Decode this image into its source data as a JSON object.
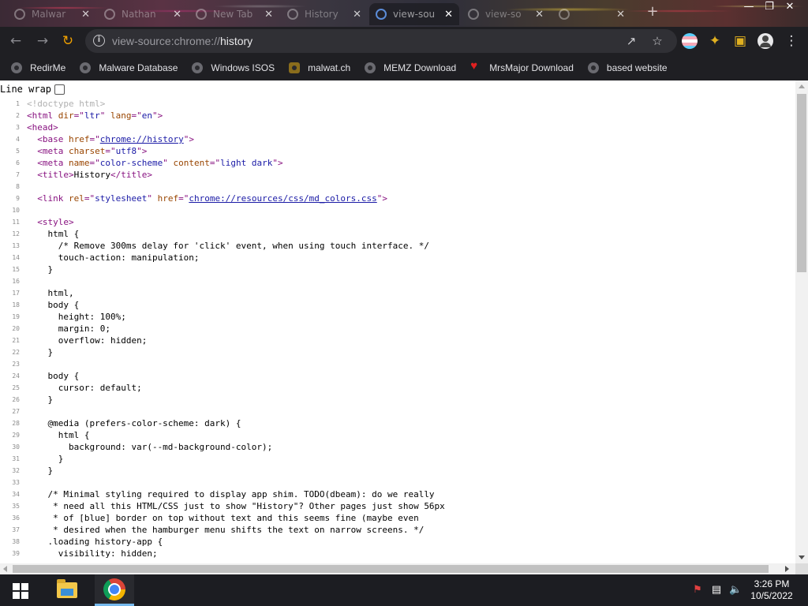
{
  "tabs": [
    {
      "title": "Malwar",
      "active": false
    },
    {
      "title": "Nathan",
      "active": false
    },
    {
      "title": "New Tab",
      "active": false
    },
    {
      "title": "History",
      "active": false
    },
    {
      "title": "view-sou",
      "active": true
    },
    {
      "title": "view-so",
      "active": false
    },
    {
      "title": "",
      "active": false
    }
  ],
  "tab_close_glyph": "✕",
  "new_tab_glyph": "+",
  "window_controls": {
    "minimize": "—",
    "maximize": "❐",
    "close": "✕"
  },
  "omnibox": {
    "scheme": "view-source:chrome://",
    "path": "history",
    "info_icon": "info-icon"
  },
  "bookmarks": [
    {
      "label": "RedirMe",
      "icon": "globe-icon"
    },
    {
      "label": "Malware Database",
      "icon": "globe-icon"
    },
    {
      "label": "Windows ISOS",
      "icon": "globe-icon"
    },
    {
      "label": "malwat.ch",
      "icon": "malwatch-icon"
    },
    {
      "label": "MEMZ Download",
      "icon": "globe-icon"
    },
    {
      "label": "MrsMajor Download",
      "icon": "heart-icon"
    },
    {
      "label": "based website",
      "icon": "globe-icon"
    }
  ],
  "line_wrap_label": "Line wrap",
  "source_lines": [
    {
      "n": "1",
      "html": "<span class='cmt'>&lt;!doctype html&gt;</span>"
    },
    {
      "n": "2",
      "html": "<span class='tag'>&lt;html </span><span class='attr'>dir</span><span class='tag'>=\"</span><span class='val'>ltr</span><span class='tag'>\" </span><span class='attr'>lang</span><span class='tag'>=\"</span><span class='val'>en</span><span class='tag'>\"&gt;</span>"
    },
    {
      "n": "3",
      "html": "<span class='tag'>&lt;head&gt;</span>"
    },
    {
      "n": "4",
      "html": "  <span class='tag'>&lt;base </span><span class='attr'>href</span><span class='tag'>=\"</span><span class='lnk'>chrome://history</span><span class='tag'>\"&gt;</span>"
    },
    {
      "n": "5",
      "html": "  <span class='tag'>&lt;meta </span><span class='attr'>charset</span><span class='tag'>=\"</span><span class='val'>utf8</span><span class='tag'>\"&gt;</span>"
    },
    {
      "n": "6",
      "html": "  <span class='tag'>&lt;meta </span><span class='attr'>name</span><span class='tag'>=\"</span><span class='val'>color-scheme</span><span class='tag'>\" </span><span class='attr'>content</span><span class='tag'>=\"</span><span class='val'>light dark</span><span class='tag'>\"&gt;</span>"
    },
    {
      "n": "7",
      "html": "  <span class='tag'>&lt;title&gt;</span>History<span class='tag'>&lt;/title&gt;</span>"
    },
    {
      "n": "8",
      "html": ""
    },
    {
      "n": "9",
      "html": "  <span class='tag'>&lt;link </span><span class='attr'>rel</span><span class='tag'>=\"</span><span class='val'>stylesheet</span><span class='tag'>\" </span><span class='attr'>href</span><span class='tag'>=\"</span><span class='lnk'>chrome://resources/css/md_colors.css</span><span class='tag'>\"&gt;</span>"
    },
    {
      "n": "10",
      "html": ""
    },
    {
      "n": "11",
      "html": "  <span class='tag'>&lt;style&gt;</span>"
    },
    {
      "n": "12",
      "html": "    html {"
    },
    {
      "n": "13",
      "html": "      /* Remove 300ms delay for 'click' event, when using touch interface. */"
    },
    {
      "n": "14",
      "html": "      touch-action: manipulation;"
    },
    {
      "n": "15",
      "html": "    }"
    },
    {
      "n": "16",
      "html": ""
    },
    {
      "n": "17",
      "html": "    html,"
    },
    {
      "n": "18",
      "html": "    body {"
    },
    {
      "n": "19",
      "html": "      height: 100%;"
    },
    {
      "n": "20",
      "html": "      margin: 0;"
    },
    {
      "n": "21",
      "html": "      overflow: hidden;"
    },
    {
      "n": "22",
      "html": "    }"
    },
    {
      "n": "23",
      "html": ""
    },
    {
      "n": "24",
      "html": "    body {"
    },
    {
      "n": "25",
      "html": "      cursor: default;"
    },
    {
      "n": "26",
      "html": "    }"
    },
    {
      "n": "27",
      "html": ""
    },
    {
      "n": "28",
      "html": "    @media (prefers-color-scheme: dark) {"
    },
    {
      "n": "29",
      "html": "      html {"
    },
    {
      "n": "30",
      "html": "        background: var(--md-background-color);"
    },
    {
      "n": "31",
      "html": "      }"
    },
    {
      "n": "32",
      "html": "    }"
    },
    {
      "n": "33",
      "html": ""
    },
    {
      "n": "34",
      "html": "    /* Minimal styling required to display app shim. TODO(dbeam): do we really"
    },
    {
      "n": "35",
      "html": "     * need all this HTML/CSS just to show \"History\"? Other pages just show 56px"
    },
    {
      "n": "36",
      "html": "     * of [blue] border on top without text and this seems fine (maybe even"
    },
    {
      "n": "37",
      "html": "     * desired when the hamburger menu shifts the text on narrow screens. */"
    },
    {
      "n": "38",
      "html": "    .loading history-app {"
    },
    {
      "n": "39",
      "html": "      visibility: hidden;"
    }
  ],
  "taskbar": {
    "apps": [
      {
        "name": "File Explorer",
        "icon": "folder-icon",
        "running": false
      },
      {
        "name": "Google Chrome",
        "icon": "chrome-icon",
        "running": true
      }
    ],
    "time": "3:26 PM",
    "date": "10/5/2022"
  }
}
